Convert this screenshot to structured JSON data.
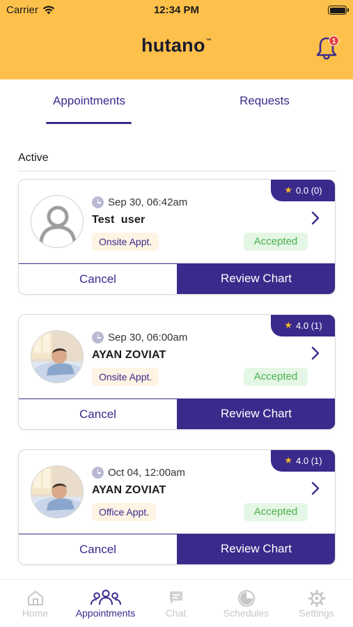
{
  "status_bar": {
    "carrier": "Carrier",
    "time": "12:34 PM"
  },
  "header": {
    "logo": "hutano",
    "logo_mark": "™",
    "notification_count": "1"
  },
  "tabs": [
    {
      "label": "Appointments",
      "active": true
    },
    {
      "label": "Requests",
      "active": false
    }
  ],
  "section": {
    "title": "Active"
  },
  "appointments": [
    {
      "datetime": "Sep 30, 06:42am",
      "name": "Test  user",
      "type": "Onsite Appt.",
      "status": "Accepted",
      "rating": "0.0 (0)",
      "avatar": "default-avatar",
      "cancel_label": "Cancel",
      "review_label": "Review Chart"
    },
    {
      "datetime": "Sep 30, 06:00am",
      "name": "AYAN ZOVIAT",
      "type": "Onsite Appt.",
      "status": "Accepted",
      "rating": "4.0 (1)",
      "avatar": "photo-avatar",
      "cancel_label": "Cancel",
      "review_label": "Review Chart"
    },
    {
      "datetime": "Oct 04, 12:00am",
      "name": "AYAN ZOVIAT",
      "type": "Office Appt.",
      "status": "Accepted",
      "rating": "4.0 (1)",
      "avatar": "photo-avatar",
      "cancel_label": "Cancel",
      "review_label": "Review Chart"
    }
  ],
  "tabbar": {
    "items": [
      {
        "label": "Home",
        "icon": "home-icon",
        "active": false
      },
      {
        "label": "Appointments",
        "icon": "people-icon",
        "active": true
      },
      {
        "label": "Chat",
        "icon": "chat-icon",
        "active": false
      },
      {
        "label": "Schedules",
        "icon": "schedule-icon",
        "active": false
      },
      {
        "label": "Settings",
        "icon": "gear-icon",
        "active": false
      }
    ]
  },
  "colors": {
    "header": "#FDC04A",
    "primary": "#3A2A8C",
    "accepted_text": "#4CB050",
    "accepted_bg": "#E4F6E4",
    "appt_type_bg": "#FFF3E3",
    "star": "#F8B925",
    "badge": "#E8413B"
  }
}
